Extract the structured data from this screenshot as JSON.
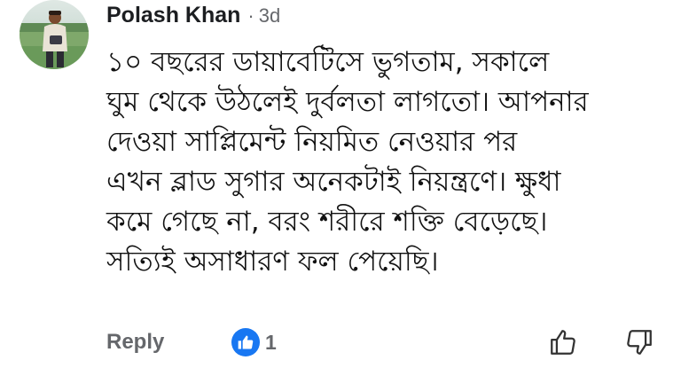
{
  "comment": {
    "author": "Polash Khan",
    "separator": "·",
    "time": "3d",
    "body_lines": [
      "১০ বছরের ডায়াবেটিসে ভুগতাম, সকালে",
      "ঘুম থেকে উঠলেই দুর্বলতা লাগতো। আপনার",
      "দেওয়া সাপ্লিমেন্ট নিয়মিত নেওয়ার পর",
      "এখন ব্লাড সুগার অনেকটাই নিয়ন্ত্রণে। ক্ষুধা",
      "কমে গেছে না, বরং শরীরে শক্তি বেড়েছে।",
      "সত্যিই অসাধারণ ফল পেয়েছি।"
    ]
  },
  "actions": {
    "reply_label": "Reply",
    "reaction_count": "1",
    "reaction_icon": "like-icon",
    "upvote_icon": "thumbs-up-outline-icon",
    "downvote_icon": "thumbs-down-outline-icon"
  },
  "colors": {
    "like_blue": "#1877f2",
    "muted_text": "#65676b",
    "text": "#111111"
  }
}
